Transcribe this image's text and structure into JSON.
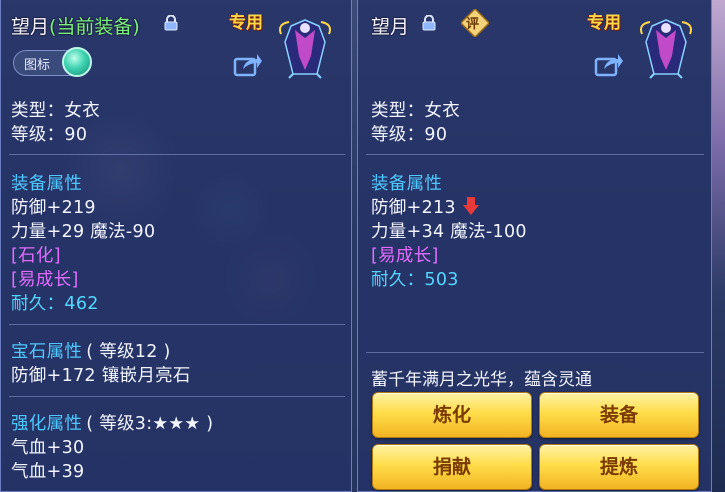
{
  "left": {
    "name": "望月",
    "current_tag": "(当前装备)",
    "exclusive": "专用",
    "toggle_label": "图标",
    "type": "类型：女衣",
    "level": "等级：90",
    "equip_section": "装备属性",
    "defense": "防御+219",
    "stats": "力量+29 魔法-90",
    "trait1": "[石化]",
    "trait2": "[易成长]",
    "durability_label": "耐久：",
    "durability_value": "462",
    "gem_section": "宝石属性",
    "gem_level": "( 等级12 )",
    "gem_effect": "防御+172 镶嵌月亮石",
    "enhance_section": "强化属性",
    "enhance_level": "( 等级3:★★★ )",
    "hp1": "气血+30",
    "hp2": "气血+39"
  },
  "right": {
    "name": "望月",
    "badge": "评",
    "exclusive": "专用",
    "type": "类型：女衣",
    "level": "等级：90",
    "equip_section": "装备属性",
    "defense": "防御+213",
    "stats": "力量+34 魔法-100",
    "trait1": "[易成长]",
    "durability_label": "耐久：",
    "durability_value": "503",
    "description": "蓄千年满月之光华，蕴含灵通",
    "buttons": [
      "炼化",
      "装备",
      "捐献",
      "提炼"
    ]
  },
  "colors": {
    "section": "#4fc8ff",
    "trait": "#e36bff",
    "durability": "#53d7ff",
    "current_tag": "#7cf07c",
    "exclusive": "#ffd84a",
    "button": "#ffdd4a",
    "decrease_arrow": "#e83a3a"
  },
  "icons": {
    "lock": "lock-icon",
    "share": "share-icon",
    "portrait": "robe-portrait-icon",
    "decrease": "red-down-arrow-icon"
  }
}
